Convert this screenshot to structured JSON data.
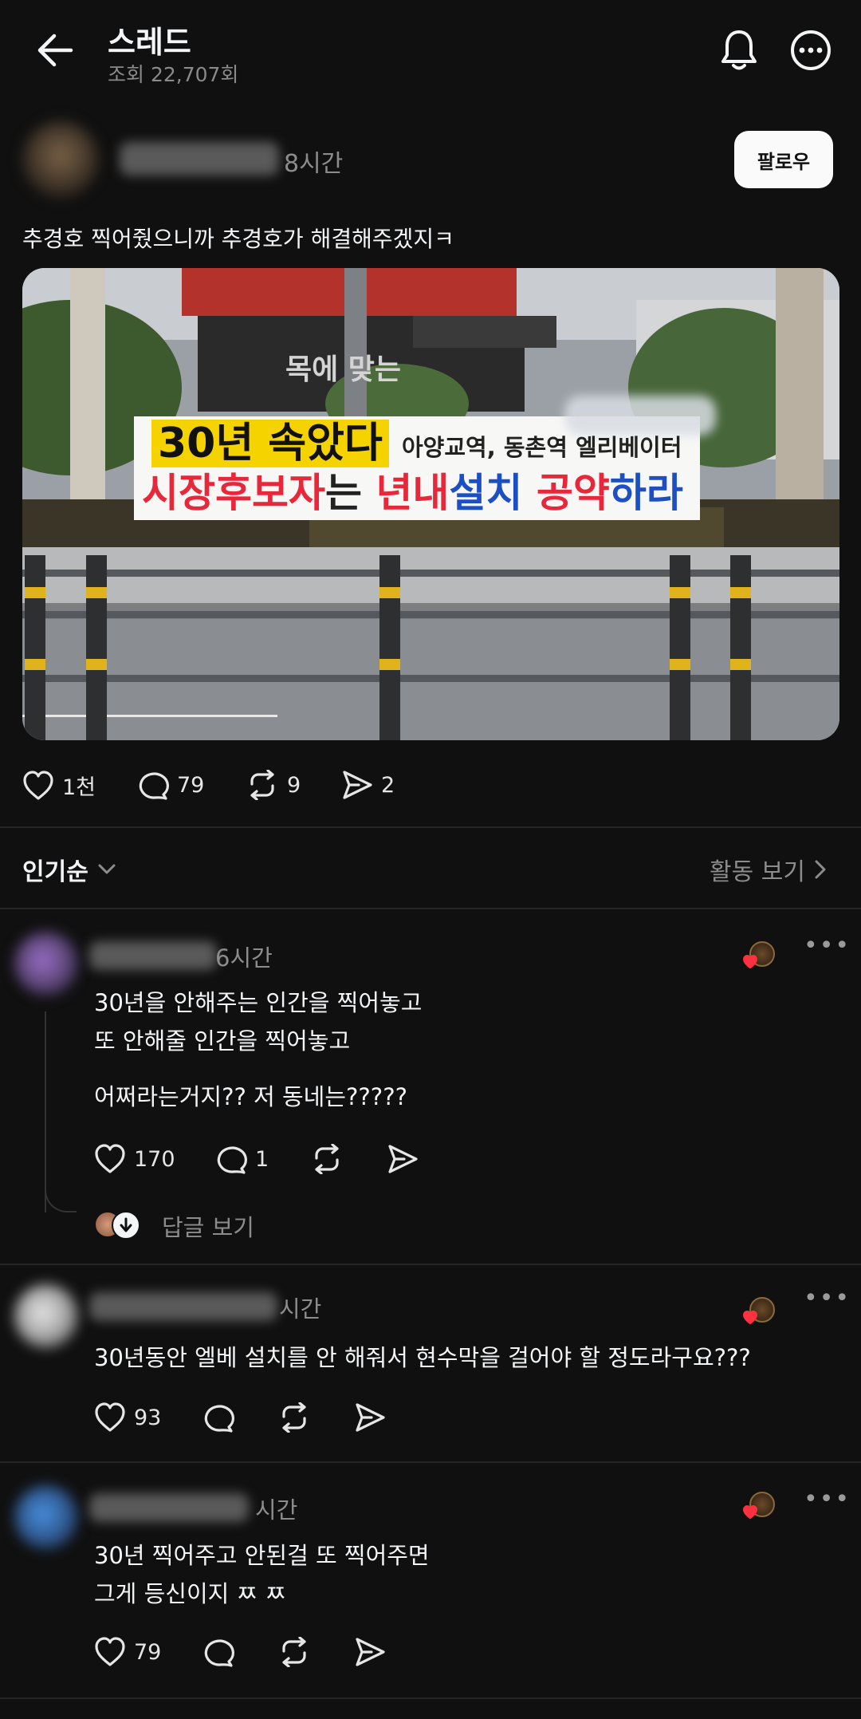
{
  "header": {
    "title": "스레드",
    "views": "조회 22,707회"
  },
  "post": {
    "time": "8시간",
    "follow_label": "팔로우",
    "text": "추경호 찍어줬으니까 추경호가 해결해주겠지ㅋ",
    "image": {
      "banner_line1_big": "30년 속았다",
      "banner_line1_small": "아양교역, 동촌역 엘리베이터",
      "banner_line2_a": "시장후보자",
      "banner_line2_b": "는 ",
      "banner_line2_c": "년내",
      "banner_line2_d": "설치",
      "banner_line2_e": " 공약",
      "banner_line2_f": "하라",
      "bg_sign": "목에 맞는"
    },
    "stats": {
      "likes": "1천",
      "comments": "79",
      "reposts": "9",
      "shares": "2"
    }
  },
  "sort": {
    "label": "인기순",
    "activity": "활동 보기"
  },
  "comments": [
    {
      "time": "6시간",
      "lines": [
        "30년을 안해주는 인간을 찍어놓고",
        "또 안해줄 인간을 찍어놓고"
      ],
      "line3": "어쩌라는거지?? 저 동네는?????",
      "likes": "170",
      "replies": "1",
      "view_replies": "답글 보기"
    },
    {
      "time": "시간",
      "lines": [
        "30년동안 엘베 설치를 안 해줘서 현수막을 걸어야 할 정도라구요???"
      ],
      "likes": "93"
    },
    {
      "time": "시간",
      "lines": [
        "30년 찍어주고 안된걸 또 찍어주면",
        "그게 등신이지 ㅉ ㅉ"
      ],
      "likes": "79"
    }
  ],
  "colors": {
    "background": "#101010",
    "heart_red": "#ff3040",
    "banner_red": "#e8283a",
    "banner_blue": "#1d4fc4",
    "banner_yellow": "#f5d300"
  }
}
